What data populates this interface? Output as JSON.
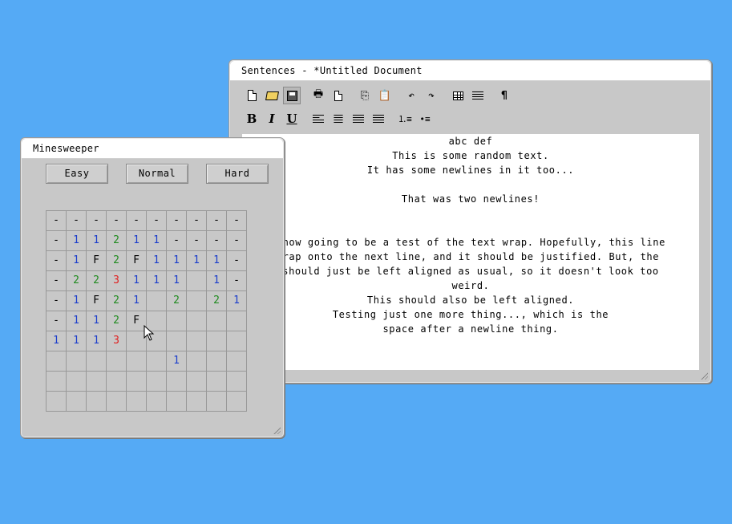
{
  "sentences_window": {
    "title": "Sentences - *Untitled Document",
    "toolbar_icons": [
      "new-document-icon",
      "open-folder-icon",
      "save-icon",
      "print-icon",
      "print-preview-icon",
      "copy-icon",
      "paste-icon",
      "undo-icon",
      "redo-icon",
      "table-icon",
      "columns-icon",
      "pilcrow-icon"
    ],
    "format_buttons": {
      "bold": "B",
      "italic": "I",
      "underline": "U"
    },
    "format_icons": [
      "align-left-icon",
      "align-center-icon",
      "align-right-icon",
      "align-justify-icon",
      "numbered-list-icon",
      "bulleted-list-icon"
    ],
    "document_lines": [
      "abc def",
      "This is some random text.",
      "It has some newlines in it too...",
      "",
      "That was two newlines!",
      "",
      "",
      "This is now going to be a test of the text wrap. Hopefully, this line",
      "should wrap onto the next line, and it should be justified. But, the",
      "last line should just be left aligned as usual, so it doesn't look too",
      "weird.",
      "This should also be left aligned.",
      "Testing just one more thing..., which is the",
      "space after a newline thing."
    ]
  },
  "minesweeper_window": {
    "title": "Minesweeper",
    "buttons": {
      "easy": "Easy",
      "normal": "Normal",
      "hard": "Hard"
    },
    "board": [
      [
        "-",
        "-",
        "-",
        "-",
        "-",
        "-",
        "-",
        "-",
        "-",
        "-"
      ],
      [
        "-",
        "1",
        "1",
        "2",
        "1",
        "1",
        "-",
        "-",
        "-",
        "-"
      ],
      [
        "-",
        "1",
        "F",
        "2",
        "F",
        "1",
        "1",
        "1",
        "1",
        "-"
      ],
      [
        "-",
        "2",
        "2",
        "3",
        "1",
        "1",
        "1",
        "",
        "1",
        "-"
      ],
      [
        "-",
        "1",
        "F",
        "2",
        "1",
        "",
        "2",
        "",
        "2",
        "1"
      ],
      [
        "-",
        "1",
        "1",
        "2",
        "F",
        "",
        "",
        "",
        "",
        ""
      ],
      [
        "1",
        "1",
        "1",
        "3",
        "",
        "",
        "",
        "",
        "",
        ""
      ],
      [
        "",
        "",
        "",
        "",
        "",
        "",
        "1",
        "",
        "",
        ""
      ],
      [
        "",
        "",
        "",
        "",
        "",
        "",
        "",
        "",
        "",
        ""
      ],
      [
        "",
        "",
        "",
        "",
        "",
        "",
        "",
        "",
        "",
        ""
      ]
    ]
  },
  "colors": {
    "desktop": "#55aaf5",
    "one": "#1a3dcc",
    "two": "#1e8a1e",
    "three": "#e02020"
  }
}
